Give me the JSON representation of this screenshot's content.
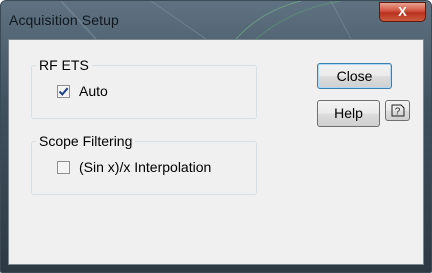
{
  "window": {
    "title": "Acquisition Setup",
    "close_glyph": "X"
  },
  "groups": {
    "rf_ets": {
      "title": "RF ETS",
      "checkbox_label": "Auto",
      "checked": true
    },
    "scope_filtering": {
      "title": "Scope Filtering",
      "checkbox_label": "(Sin x)/x Interpolation",
      "checked": false
    }
  },
  "buttons": {
    "close": "Close",
    "help": "Help"
  },
  "icons": {
    "context_help": "context-help-icon",
    "check": "checkmark-icon"
  }
}
